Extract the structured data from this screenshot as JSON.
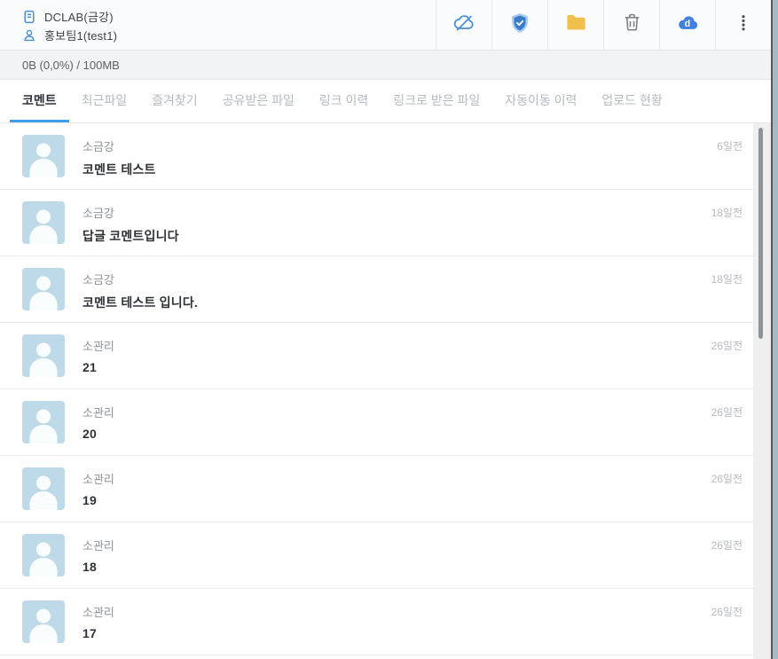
{
  "header": {
    "team": "DCLAB(금강)",
    "user": "홍보팀1(test1)",
    "toolbar_icons": [
      "cloud-off",
      "shield-check",
      "folder",
      "trash",
      "cloud-sync",
      "more-options"
    ]
  },
  "storage": {
    "usage_text": "0B (0,0%) / 100MB"
  },
  "tabs": [
    {
      "label": "코멘트",
      "active": true
    },
    {
      "label": "최근파일",
      "active": false
    },
    {
      "label": "즐겨찾기",
      "active": false
    },
    {
      "label": "공유받은 파일",
      "active": false
    },
    {
      "label": "링크 이력",
      "active": false
    },
    {
      "label": "링크로 받은 파일",
      "active": false
    },
    {
      "label": "자동이동 이력",
      "active": false
    },
    {
      "label": "업로드 현황",
      "active": false
    }
  ],
  "comments": [
    {
      "author": "소금강",
      "text": "코멘트 테스트",
      "time": "6일전"
    },
    {
      "author": "소금강",
      "text": "답글 코멘트입니다",
      "time": "18일전"
    },
    {
      "author": "소금강",
      "text": "코멘트 테스트 입니다.",
      "time": "18일전"
    },
    {
      "author": "소관리",
      "text": "21",
      "time": "26일전"
    },
    {
      "author": "소관리",
      "text": "20",
      "time": "26일전"
    },
    {
      "author": "소관리",
      "text": "19",
      "time": "26일전"
    },
    {
      "author": "소관리",
      "text": "18",
      "time": "26일전"
    },
    {
      "author": "소관리",
      "text": "17",
      "time": "26일전"
    }
  ],
  "colors": {
    "accent_blue": "#3f9ee6",
    "icon_blue": "#4a8fd6",
    "folder_yellow": "#f0bf4c",
    "avatar_blue": "#bedae9"
  }
}
